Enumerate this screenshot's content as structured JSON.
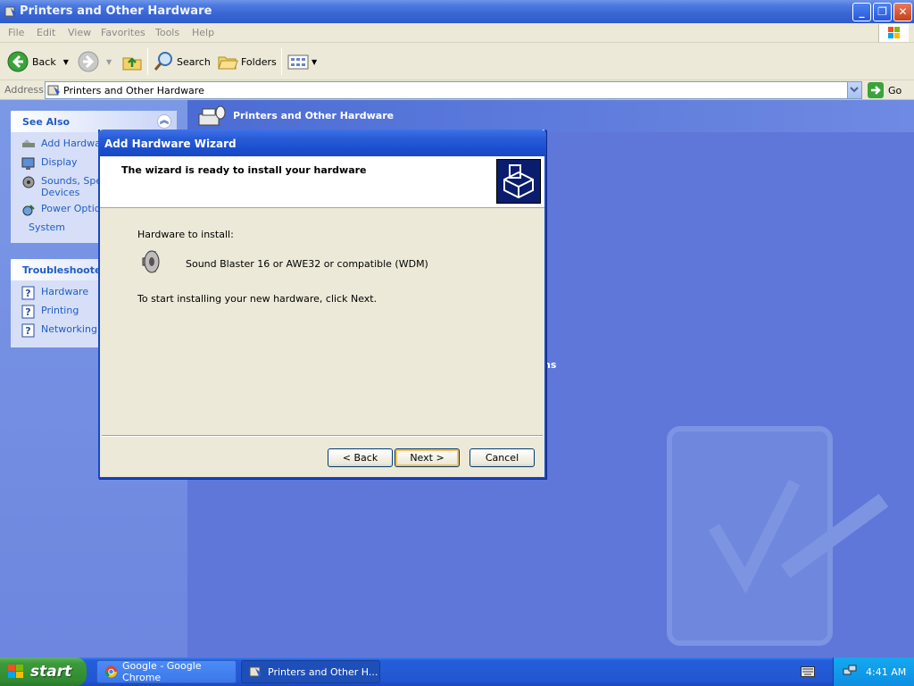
{
  "window": {
    "title": "Printers and Other Hardware"
  },
  "menu": {
    "items": [
      "File",
      "Edit",
      "View",
      "Favorites",
      "Tools",
      "Help"
    ]
  },
  "toolbar": {
    "back_label": "Back",
    "search_label": "Search",
    "folders_label": "Folders"
  },
  "address": {
    "label": "Address",
    "value": "Printers and Other Hardware",
    "go_label": "Go"
  },
  "content": {
    "pane_title": "Printers and Other Hardware",
    "partial_text": "ns"
  },
  "see_also": {
    "title": "See Also",
    "items": [
      {
        "label": "Add Hardware",
        "icon": "add-hardware-icon"
      },
      {
        "label": "Display",
        "icon": "display-icon"
      },
      {
        "label": "Sounds, Speech, and Audio Devices",
        "icon": "speaker-icon"
      },
      {
        "label": "Power Options",
        "icon": "power-icon"
      },
      {
        "label": "System",
        "icon": ""
      }
    ]
  },
  "troubleshooters": {
    "title": "Troubleshooters",
    "items": [
      {
        "label": "Hardware",
        "icon": "help-icon"
      },
      {
        "label": "Printing",
        "icon": "help-icon"
      },
      {
        "label": "Networking",
        "icon": "help-icon"
      }
    ]
  },
  "dialog": {
    "title": "Add Hardware Wizard",
    "heading": "The wizard is ready to install your hardware",
    "hardware_label": "Hardware to install:",
    "device_name": "Sound Blaster 16 or AWE32 or compatible (WDM)",
    "instruction": "To start installing your new hardware, click Next.",
    "back_button": "< Back",
    "next_button": "Next >",
    "cancel_button": "Cancel"
  },
  "taskbar": {
    "start_label": "start",
    "tasks": [
      {
        "label": "Google - Google Chrome",
        "active": false
      },
      {
        "label": "Printers and Other H...",
        "active": true
      }
    ],
    "clock": "4:41 AM"
  },
  "colors": {
    "xp_blue": "#245edb",
    "start_green": "#3c9a3c",
    "dialog_face": "#ece9d8",
    "link_blue": "#215dc6"
  }
}
